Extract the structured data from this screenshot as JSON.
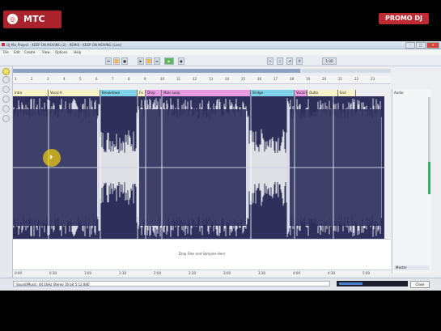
{
  "window": {
    "title": "DJ Mix Project - KEEP ON MOVING (2) - REMIX - KEEP ON MOVING (Live)"
  },
  "menu": {
    "items": [
      "File",
      "Edit",
      "Create",
      "View",
      "Options",
      "Help"
    ]
  },
  "watermark": {
    "logo_text": "MTC",
    "promo_text": "PROMO DJ"
  },
  "toolbar": {
    "zoom": "1:00",
    "buttons": [
      "⏮",
      "⏪",
      "■",
      "▶",
      "⏩",
      "⏭"
    ]
  },
  "ruler": {
    "marks": [
      "1",
      "2",
      "3",
      "4",
      "5",
      "6",
      "7",
      "8",
      "9",
      "10",
      "11",
      "12",
      "13",
      "14",
      "15",
      "16",
      "17",
      "18",
      "19",
      "20",
      "21",
      "22",
      "23"
    ]
  },
  "tracks": {
    "segments": [
      {
        "label": "Intro",
        "color": "#f7f3c9"
      },
      {
        "label": "Vocal A",
        "color": "#f7f3c9"
      },
      {
        "label": "Breakdown",
        "color": "#7fd3e9"
      },
      {
        "label": "Fx",
        "color": "#f7f3c9"
      },
      {
        "label": "Drop",
        "color": "#e99be0"
      },
      {
        "label": "Main Loop",
        "color": "#e99be0"
      },
      {
        "label": "Bridge",
        "color": "#7fd3e9"
      },
      {
        "label": "Vocal B",
        "color": "#e99be0"
      },
      {
        "label": "Outro",
        "color": "#f7f3c9"
      },
      {
        "label": "End",
        "color": "#f7f3c9"
      }
    ]
  },
  "dropzone": {
    "text": "Drop Files and Samples Here"
  },
  "timeline": {
    "ticks": [
      "0:00",
      "0:30",
      "1:00",
      "1:30",
      "2:00",
      "2:30",
      "3:00",
      "3:30",
      "4:00",
      "4:30",
      "5:00"
    ]
  },
  "right_panel": {
    "header": "Audio",
    "footer": "Master"
  },
  "status": {
    "text": "Sound/Music: 44.1kHz  Stereo  16 bit  5:12.840",
    "close_label": "Close",
    "meter_level": 0.35
  },
  "progress": {
    "value": 0.76
  }
}
